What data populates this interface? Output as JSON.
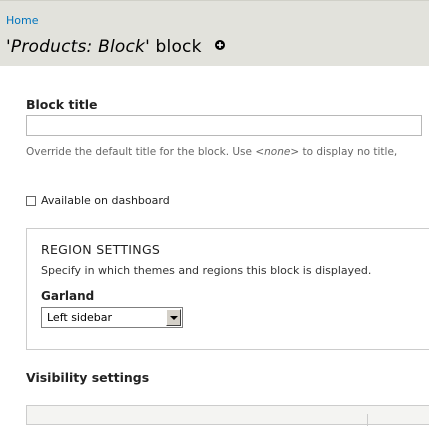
{
  "breadcrumb": {
    "home": "Home"
  },
  "title": {
    "prefix": "'",
    "name": "Products: Block",
    "suffix": "' block",
    "add_icon": "plus-circle-icon"
  },
  "block_title": {
    "label": "Block title",
    "value": "",
    "description_pre": "Override the default title for the block. Use ",
    "description_em": "<none>",
    "description_post": " to display no title,"
  },
  "dashboard": {
    "label": "Available on dashboard",
    "checked": false
  },
  "region_settings": {
    "legend": "REGION SETTINGS",
    "description": "Specify in which themes and regions this block is displayed.",
    "theme_label": "Garland",
    "region_value": "Left sidebar"
  },
  "visibility": {
    "label": "Visibility settings"
  }
}
